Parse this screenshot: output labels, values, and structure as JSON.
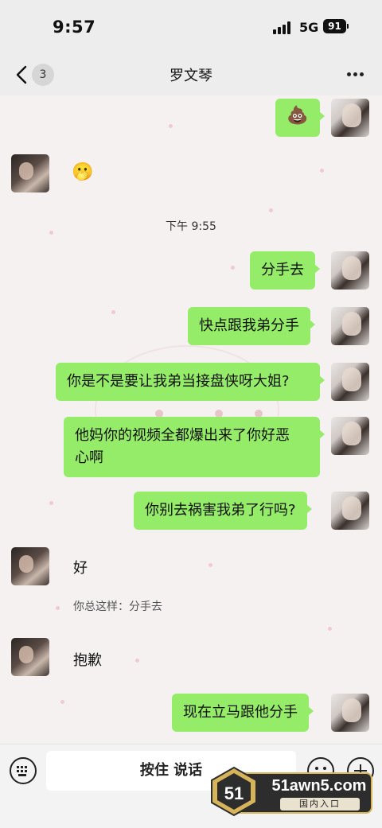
{
  "status_bar": {
    "time": "9:57",
    "network": "5G",
    "battery": "91"
  },
  "header": {
    "back_count": "3",
    "title": "罗文琴"
  },
  "messages": [
    {
      "from": "self",
      "emoji": "💩"
    },
    {
      "from": "other",
      "emoji": "🫢"
    },
    {
      "type": "time",
      "text": "下午 9:55"
    },
    {
      "from": "self",
      "text": "分手去"
    },
    {
      "from": "self",
      "text": "快点跟我弟分手"
    },
    {
      "from": "self",
      "text": "你是不是要让我弟当接盘侠呀大姐?"
    },
    {
      "from": "self",
      "text_line1": "他妈你的视频全都爆出来了你好恶",
      "text_line2": "心啊"
    },
    {
      "from": "self",
      "text": "你别去祸害我弟了行吗?"
    },
    {
      "from": "other",
      "text": "好",
      "quote": "你总这样：分手去"
    },
    {
      "from": "other",
      "text": "抱歉"
    },
    {
      "from": "self",
      "text": "现在立马跟他分手"
    }
  ],
  "input_bar": {
    "voice_label": "按住 说话"
  },
  "watermark": {
    "site": "51awn5.com",
    "sub": "国内入口",
    "badge": "51"
  },
  "colors": {
    "self_bubble": "#95ec69",
    "background": "#f5f1f1"
  },
  "icons": [
    "back-arrow-icon",
    "more-icon",
    "keyboard-icon",
    "emoji-icon",
    "plus-icon"
  ]
}
